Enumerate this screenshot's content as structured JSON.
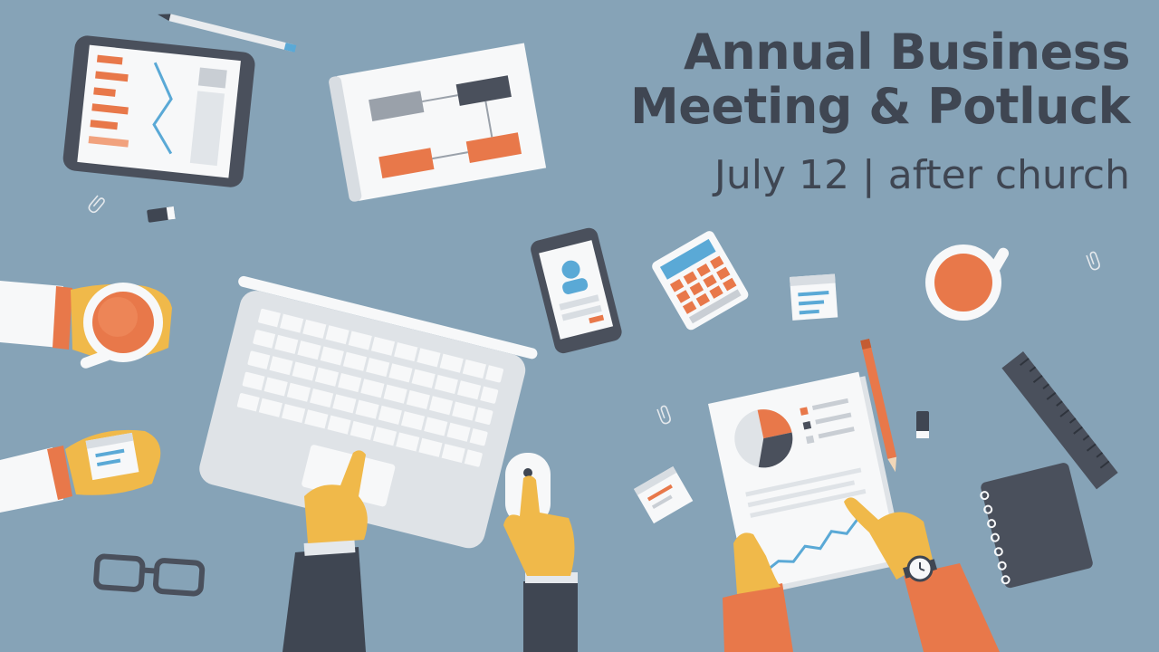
{
  "title": {
    "line1": "Annual Business",
    "line2": "Meeting & Potluck",
    "subtitle": "July 12 | after church"
  },
  "colors": {
    "background": "#86a3b7",
    "title_text": "#3f4652",
    "accent_orange": "#e8784a",
    "skin_yellow": "#f0b94a",
    "dark_slate": "#4a505c",
    "paper_white": "#f7f8f9"
  },
  "illustration": {
    "objects": [
      "pencil-icon",
      "tablet-icon",
      "flowchart-document-icon",
      "laptop-icon",
      "smartphone-icon",
      "calculator-icon",
      "coffee-cup-icon",
      "sticky-note-icon",
      "mouse-icon",
      "report-document-icon",
      "ruler-icon",
      "notebook-icon",
      "eyeglasses-icon",
      "paperclip-icon",
      "eraser-icon",
      "wristwatch-icon"
    ]
  }
}
